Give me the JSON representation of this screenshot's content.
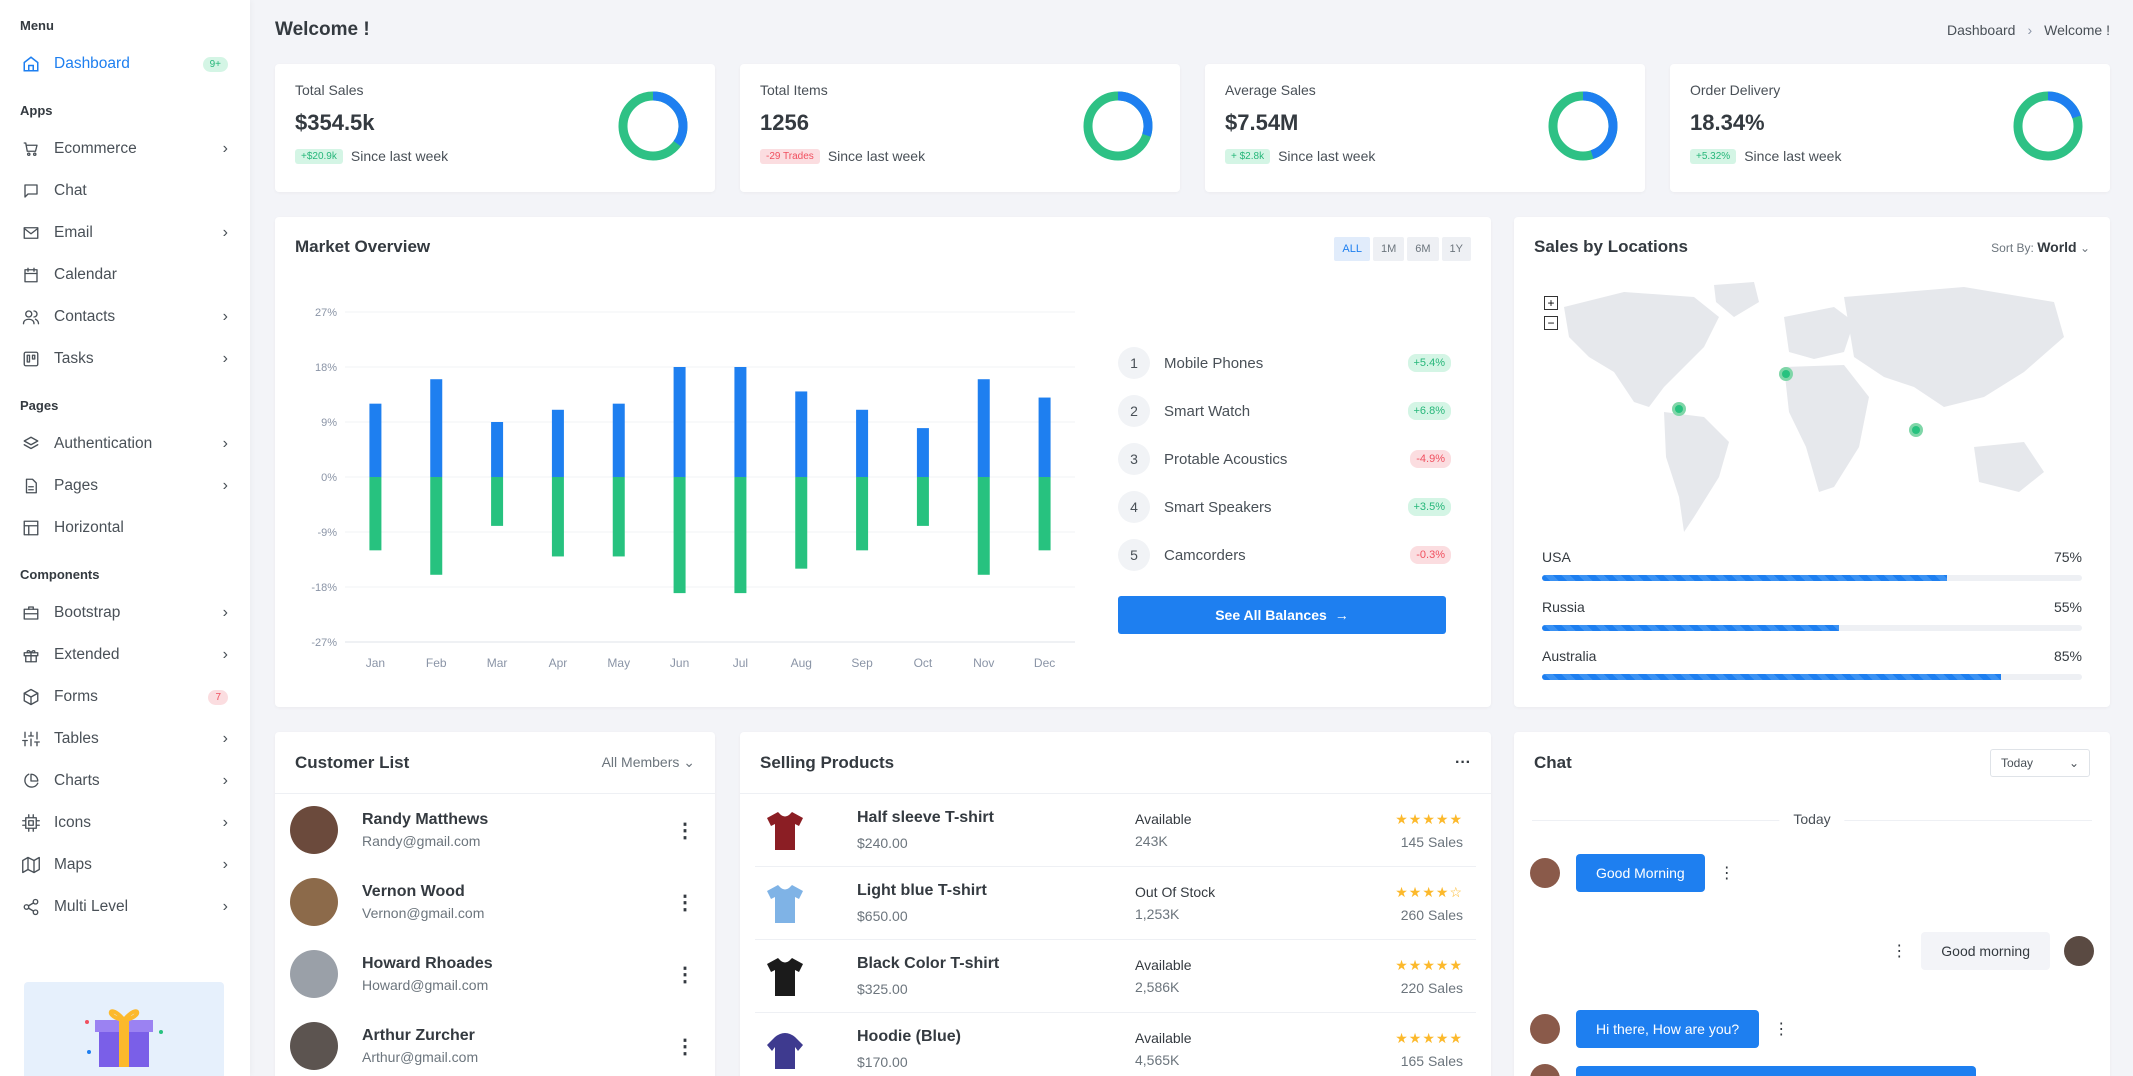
{
  "sidebar": {
    "menu_label": "Menu",
    "dashboard": {
      "label": "Dashboard",
      "badge": "9+"
    },
    "apps_label": "Apps",
    "apps": [
      {
        "label": "Ecommerce",
        "icon": "cart-icon"
      },
      {
        "label": "Chat",
        "icon": "chat-icon"
      },
      {
        "label": "Email",
        "icon": "mail-icon"
      },
      {
        "label": "Calendar",
        "icon": "calendar-icon"
      },
      {
        "label": "Contacts",
        "icon": "users-icon"
      },
      {
        "label": "Tasks",
        "icon": "trello-icon"
      }
    ],
    "pages_label": "Pages",
    "pages": [
      {
        "label": "Authentication",
        "icon": "layers-icon"
      },
      {
        "label": "Pages",
        "icon": "file-icon"
      },
      {
        "label": "Horizontal",
        "icon": "layout-icon"
      }
    ],
    "components_label": "Components",
    "components": [
      {
        "label": "Bootstrap",
        "icon": "briefcase-icon"
      },
      {
        "label": "Extended",
        "icon": "gift-icon"
      },
      {
        "label": "Forms",
        "icon": "box-icon",
        "badge": "7"
      },
      {
        "label": "Tables",
        "icon": "sliders-icon"
      },
      {
        "label": "Charts",
        "icon": "pie-chart-icon"
      },
      {
        "label": "Icons",
        "icon": "cpu-icon"
      },
      {
        "label": "Maps",
        "icon": "map-icon"
      },
      {
        "label": "Multi Level",
        "icon": "share-icon"
      }
    ]
  },
  "header": {
    "title": "Welcome !",
    "breadcrumb": [
      "Dashboard",
      "Welcome !"
    ]
  },
  "stats": [
    {
      "title": "Total Sales",
      "value": "$354.5k",
      "badge": "+$20.9k",
      "badge_type": "green",
      "note": "Since last week",
      "donut_fraction": 0.35
    },
    {
      "title": "Total Items",
      "value": "1256",
      "badge": "-29 Trades",
      "badge_type": "red",
      "note": "Since last week",
      "donut_fraction": 0.3
    },
    {
      "title": "Average Sales",
      "value": "$7.54M",
      "badge": "+ $2.8k",
      "badge_type": "green",
      "note": "Since last week",
      "donut_fraction": 0.45
    },
    {
      "title": "Order Delivery",
      "value": "18.34%",
      "badge": "+5.32%",
      "badge_type": "green",
      "note": "Since last week",
      "donut_fraction": 0.2
    }
  ],
  "market": {
    "title": "Market Overview",
    "periods": [
      "ALL",
      "1M",
      "6M",
      "1Y"
    ],
    "see_all": "See All Balances",
    "ranking": [
      {
        "rank": "1",
        "name": "Mobile Phones",
        "change": "+5.4%",
        "type": "green"
      },
      {
        "rank": "2",
        "name": "Smart Watch",
        "change": "+6.8%",
        "type": "green"
      },
      {
        "rank": "3",
        "name": "Protable Acoustics",
        "change": "-4.9%",
        "type": "red"
      },
      {
        "rank": "4",
        "name": "Smart Speakers",
        "change": "+3.5%",
        "type": "green"
      },
      {
        "rank": "5",
        "name": "Camcorders",
        "change": "-0.3%",
        "type": "red"
      }
    ]
  },
  "chart_data": {
    "type": "bar",
    "categories": [
      "Jan",
      "Feb",
      "Mar",
      "Apr",
      "May",
      "Jun",
      "Jul",
      "Aug",
      "Sep",
      "Oct",
      "Nov",
      "Dec"
    ],
    "series": [
      {
        "values": [
          12,
          16,
          9,
          11,
          12,
          18,
          18,
          14,
          11,
          8,
          16,
          13
        ],
        "color": "#1e7ff0"
      },
      {
        "values": [
          -12,
          -16,
          -8,
          -13,
          -13,
          -19,
          -19,
          -15,
          -12,
          -8,
          -16,
          -12
        ],
        "color": "#27c27f"
      }
    ],
    "yticks": [
      "27%",
      "18%",
      "9%",
      "0%",
      "-9%",
      "-18%",
      "-27%"
    ],
    "ylim": [
      -27,
      27
    ]
  },
  "locations": {
    "title": "Sales by Locations",
    "sort_label": "Sort By:",
    "sort_value": "World",
    "rows": [
      {
        "name": "USA",
        "percent_label": "75%",
        "percent": 75
      },
      {
        "name": "Russia",
        "percent_label": "55%",
        "percent": 55
      },
      {
        "name": "Australia",
        "percent_label": "85%",
        "percent": 85
      }
    ]
  },
  "customers": {
    "title": "Customer List",
    "filter": "All Members",
    "rows": [
      {
        "name": "Randy Matthews",
        "email": "Randy@gmail.com"
      },
      {
        "name": "Vernon Wood",
        "email": "Vernon@gmail.com"
      },
      {
        "name": "Howard Rhoades",
        "email": "Howard@gmail.com"
      },
      {
        "name": "Arthur Zurcher",
        "email": "Arthur@gmail.com"
      }
    ]
  },
  "selling": {
    "title": "Selling Products",
    "rows": [
      {
        "name": "Half sleeve T-shirt",
        "price": "$240.00",
        "status": "Available",
        "qty": "243K",
        "stars": "★★★★★",
        "sales": "145 Sales",
        "color": "#8b1e24"
      },
      {
        "name": "Light blue T-shirt",
        "price": "$650.00",
        "status": "Out Of Stock",
        "qty": "1,253K",
        "stars": "★★★★☆",
        "sales": "260 Sales",
        "color": "#7fb3e6"
      },
      {
        "name": "Black Color T-shirt",
        "price": "$325.00",
        "status": "Available",
        "qty": "2,586K",
        "stars": "★★★★★",
        "sales": "220 Sales",
        "color": "#1b1b1b"
      },
      {
        "name": "Hoodie (Blue)",
        "price": "$170.00",
        "status": "Available",
        "qty": "4,565K",
        "stars": "★★★★★",
        "sales": "165 Sales",
        "color": "#3e3a8f"
      }
    ]
  },
  "chat": {
    "title": "Chat",
    "filter": "Today",
    "divider": "Today",
    "messages": [
      {
        "text": "Good Morning",
        "dir": "in"
      },
      {
        "text": "Good morning",
        "dir": "out"
      },
      {
        "text": "Hi there, How are you?",
        "dir": "in"
      }
    ]
  }
}
